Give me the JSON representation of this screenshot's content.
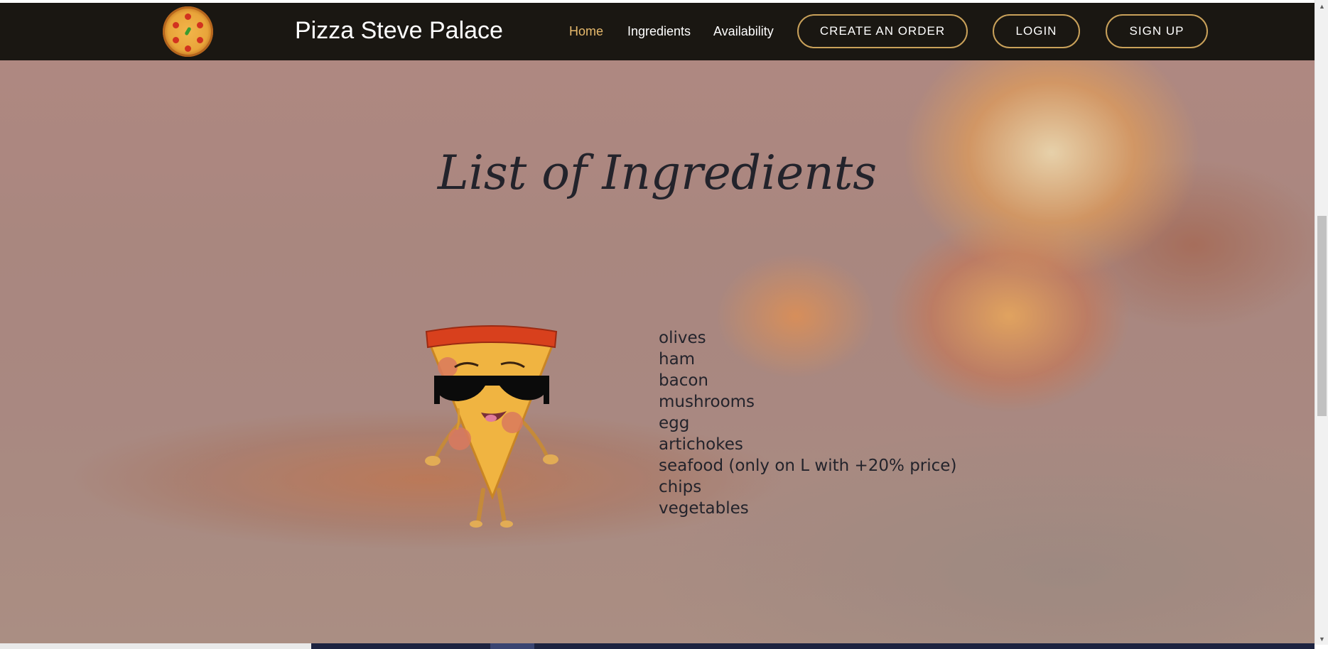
{
  "navbar": {
    "brand": "Pizza Steve Palace",
    "links": [
      {
        "label": "Home",
        "active": true
      },
      {
        "label": "Ingredients",
        "active": false
      },
      {
        "label": "Availability",
        "active": false
      }
    ],
    "buttons": {
      "create_order": "CREATE AN ORDER",
      "login": "LOGIN",
      "signup": "SIGN UP"
    },
    "accent_color": "#e6b96c",
    "background_color": "#1a1712"
  },
  "main": {
    "title": "List of Ingredients",
    "ingredients": [
      "olives",
      "ham",
      "bacon",
      "mushrooms",
      "egg",
      "artichokes",
      "seafood (only on L with +20% price)",
      "chips",
      "vegetables"
    ],
    "mascot": "pizza-slice-with-sunglasses",
    "background": "pizza-oven-fire"
  },
  "icons": {
    "logo": "pizza-logo-icon"
  }
}
